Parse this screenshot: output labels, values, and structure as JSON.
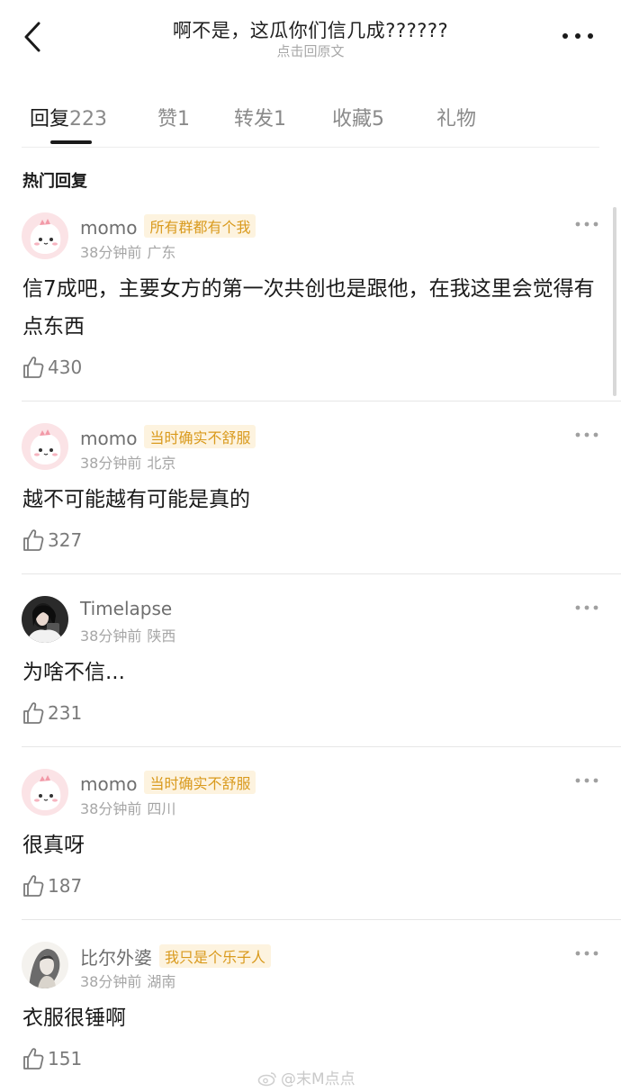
{
  "header": {
    "title": "啊不是，这瓜你们信几成??????",
    "subtitle": "点击回原文"
  },
  "tabs": [
    {
      "label": "回复",
      "count": "223"
    },
    {
      "label": "赞",
      "count": "1"
    },
    {
      "label": "转发",
      "count": "1"
    },
    {
      "label": "收藏",
      "count": "5"
    },
    {
      "label": "礼物",
      "count": ""
    }
  ],
  "section_label": "热门回复",
  "comments": [
    {
      "username": "momo",
      "badge": "所有群都有个我",
      "time": "38分钟前",
      "location": "广东",
      "text": "信7成吧，主要女方的第一次共创也是跟他，在我这里会觉得有点东西",
      "likes": "430"
    },
    {
      "username": "momo",
      "badge": "当时确实不舒服",
      "time": "38分钟前",
      "location": "北京",
      "text": "越不可能越有可能是真的",
      "likes": "327"
    },
    {
      "username": "Timelapse",
      "badge": "",
      "time": "38分钟前",
      "location": "陕西",
      "text": "为啥不信...",
      "likes": "231"
    },
    {
      "username": "momo",
      "badge": "当时确实不舒服",
      "time": "38分钟前",
      "location": "四川",
      "text": "很真呀",
      "likes": "187"
    },
    {
      "username": "比尔外婆",
      "badge": "我只是个乐子人",
      "time": "38分钟前",
      "location": "湖南",
      "text": "衣服很锤啊",
      "likes": "151"
    }
  ],
  "watermark": "@末M点点"
}
